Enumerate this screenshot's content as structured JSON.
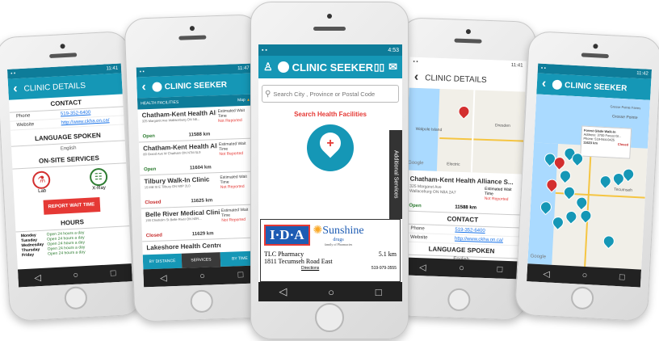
{
  "phone1": {
    "status_time": "11:41",
    "title": "CLINIC DETAILS",
    "contact_header": "CONTACT",
    "phone_label": "Phone",
    "phone_value": "519-352-6400",
    "website_label": "Website",
    "website_value": "http://www.ckha.on.ca/",
    "language_header": "LANGUAGE SPOKEN",
    "language_value": "English",
    "services_header": "ON-SITE SERVICES",
    "service1": "Lab",
    "service2": "X-Ray",
    "report_button": "REPORT WAIT TIME",
    "hours_header": "HOURS",
    "hours": [
      {
        "day": "Monday",
        "time": "Open 24 hours a day"
      },
      {
        "day": "Tuesday",
        "time": "Open 24 hours a day"
      },
      {
        "day": "Wednesday",
        "time": "Open 24 hours a day"
      },
      {
        "day": "Thursday",
        "time": "Open 24 hours a day"
      },
      {
        "day": "Friday",
        "time": "Open 24 hours a day"
      }
    ]
  },
  "phone2": {
    "status_time": "11:47",
    "title": "CLINIC SEEKER",
    "subheader": "HEALTH FACILITIES",
    "map_label": "Map",
    "wait_label": "Estimated Wait Time",
    "items": [
      {
        "name": "Chatham-Kent Health All...",
        "addr": "325 Margaret Ave Wallaceburg ON N8...",
        "status": "Open",
        "dist": "11588 km",
        "wait": "Not Reported"
      },
      {
        "name": "Chatham-Kent Health All...",
        "addr": "80 Grand Ave W Chatham ON N7M 5L9",
        "status": "Open",
        "dist": "11604 km",
        "wait": "Not Reported"
      },
      {
        "name": "Tilbury Walk-In Clinic",
        "addr": "15 Mill St E Tilbury ON N0P 2L0",
        "status": "Closed",
        "dist": "11625 km",
        "wait": "Not Reported"
      },
      {
        "name": "Belle River Medical Clinic",
        "addr": "190 Chisholm St Belle River ON N0R...",
        "status": "Closed",
        "dist": "11629 km",
        "wait": "Not Reported"
      },
      {
        "name": "Lakeshore Health Centre",
        "addr": "",
        "status": "",
        "dist": "",
        "wait": ""
      }
    ],
    "tabs": [
      "BY DISTANCE",
      "SERVICES",
      "BY TIME"
    ]
  },
  "phone3": {
    "status_time": "4:53",
    "title": "CLINIC SEEKER",
    "search_placeholder": "Search City , Province or Postal Code",
    "search_label": "Search Health Facilities",
    "side_tab": "Additional Services",
    "ad_brand1": "I·D·A",
    "ad_brand2": "Sunshine",
    "ad_brand2_sub": "drugs",
    "ad_brand2_tag": "family of Pharmacies",
    "ad_name": "TLC Pharmacy",
    "ad_distance": "5.1 km",
    "ad_address": "1811 Tecumseh Road East",
    "ad_directions": "Directions",
    "ad_phone": "519-979-3555"
  },
  "phone4": {
    "status_time": "11:41",
    "title": "CLINIC DETAILS",
    "map_labels": [
      "Walpole Island",
      "Dresden",
      "Google",
      "Electric"
    ],
    "clinic_name": "Chatham-Kent Health Alliance S...",
    "addr1": "325 Margaret Ave",
    "addr2": "Wallaceburg ON N8A 2A7",
    "status": "Open",
    "dist": "11588 km",
    "wait_label": "Estimated Wait Time",
    "wait_value": "Not Reported",
    "contact_header": "CONTACT",
    "phone_label": "Phone",
    "phone_value": "519-352-6400",
    "website_label": "Website",
    "website_value": "http://www.ckha.on.ca/",
    "language_header": "LANGUAGE SPOKEN",
    "language_value": "English"
  },
  "phone5": {
    "status_time": "11:42",
    "title": "CLINIC SEEKER",
    "map_labels": [
      "Grosse Pointe",
      "Grosse Pointe Farms",
      "Tecumseh",
      "Google"
    ],
    "popup_title": "Forest Glade Walk-In",
    "popup_addr": "Address: 3700 Forest Gl...",
    "popup_phone": "Phone: 519-944-0425",
    "popup_dist": "11623 km",
    "popup_status": "Closed"
  },
  "nav": {
    "back": "◁",
    "home": "○",
    "recent": "□"
  }
}
